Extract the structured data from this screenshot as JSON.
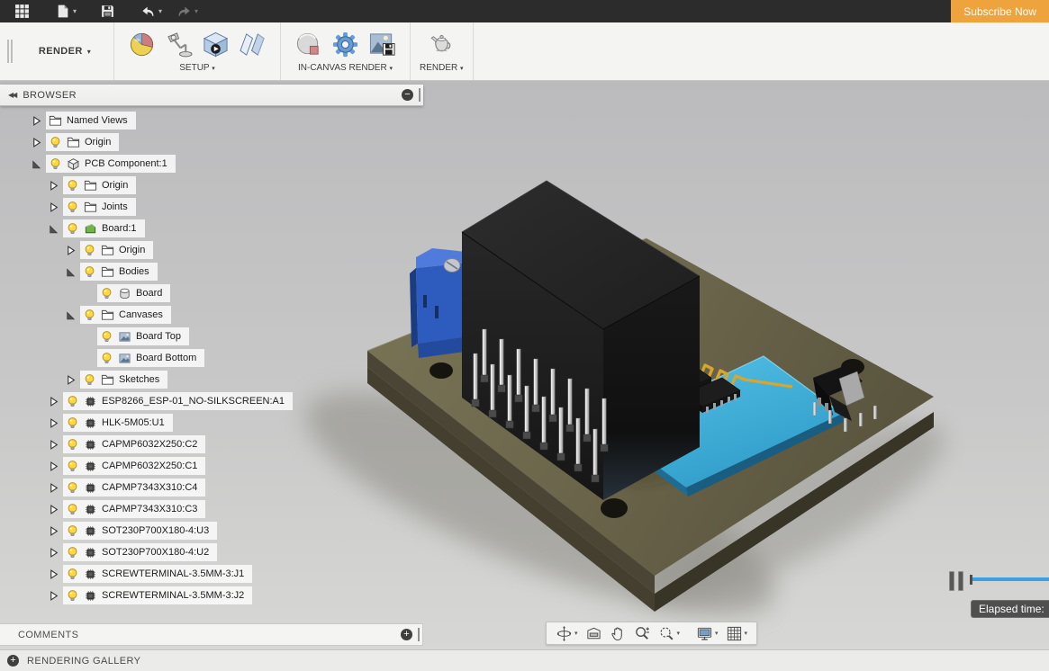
{
  "topbar": {
    "subscribe_label": "Subscribe Now",
    "icons": [
      "app-grid-icon",
      "file-icon",
      "save-icon",
      "undo-icon",
      "redo-icon"
    ]
  },
  "ribbon": {
    "workspace_label": "RENDER",
    "groups": [
      {
        "label": "SETUP",
        "icons": [
          "appearance-icon",
          "environment-icon",
          "decal-icon",
          "texture-icon"
        ]
      },
      {
        "label": "IN-CANVAS RENDER",
        "icons": [
          "incanvas-icon",
          "gear-icon",
          "capture-icon"
        ]
      },
      {
        "label": "RENDER",
        "icons": [
          "teapot-icon"
        ]
      }
    ]
  },
  "browser": {
    "title": "BROWSER",
    "tree": [
      {
        "label": "Named Views",
        "level": 0,
        "expand": "collapsed",
        "bulb": false,
        "icon": "folder"
      },
      {
        "label": "Origin",
        "level": 0,
        "expand": "collapsed",
        "bulb": true,
        "icon": "folder"
      },
      {
        "label": "PCB Component:1",
        "level": 0,
        "expand": "expanded",
        "bulb": true,
        "icon": "component"
      },
      {
        "label": "Origin",
        "level": 1,
        "expand": "collapsed",
        "bulb": true,
        "icon": "folder"
      },
      {
        "label": "Joints",
        "level": 1,
        "expand": "collapsed",
        "bulb": true,
        "icon": "folder"
      },
      {
        "label": "Board:1",
        "level": 1,
        "expand": "expanded",
        "bulb": true,
        "icon": "board"
      },
      {
        "label": "Origin",
        "level": 2,
        "expand": "collapsed",
        "bulb": true,
        "icon": "folder"
      },
      {
        "label": "Bodies",
        "level": 2,
        "expand": "expanded",
        "bulb": true,
        "icon": "folder"
      },
      {
        "label": "Board",
        "level": 3,
        "expand": "none",
        "bulb": true,
        "icon": "body"
      },
      {
        "label": "Canvases",
        "level": 2,
        "expand": "expanded",
        "bulb": true,
        "icon": "folder"
      },
      {
        "label": "Board Top",
        "level": 3,
        "expand": "none",
        "bulb": true,
        "icon": "canvas"
      },
      {
        "label": "Board Bottom",
        "level": 3,
        "expand": "none",
        "bulb": true,
        "icon": "canvas"
      },
      {
        "label": "Sketches",
        "level": 2,
        "expand": "collapsed",
        "bulb": true,
        "icon": "folder"
      },
      {
        "label": "ESP8266_ESP-01_NO-SILKSCREEN:A1",
        "level": 1,
        "expand": "collapsed",
        "bulb": true,
        "icon": "chip"
      },
      {
        "label": "HLK-5M05:U1",
        "level": 1,
        "expand": "collapsed",
        "bulb": true,
        "icon": "chip"
      },
      {
        "label": "CAPMP6032X250:C2",
        "level": 1,
        "expand": "collapsed",
        "bulb": true,
        "icon": "chip"
      },
      {
        "label": "CAPMP6032X250:C1",
        "level": 1,
        "expand": "collapsed",
        "bulb": true,
        "icon": "chip"
      },
      {
        "label": "CAPMP7343X310:C4",
        "level": 1,
        "expand": "collapsed",
        "bulb": true,
        "icon": "chip"
      },
      {
        "label": "CAPMP7343X310:C3",
        "level": 1,
        "expand": "collapsed",
        "bulb": true,
        "icon": "chip"
      },
      {
        "label": "SOT230P700X180-4:U3",
        "level": 1,
        "expand": "collapsed",
        "bulb": true,
        "icon": "chip"
      },
      {
        "label": "SOT230P700X180-4:U2",
        "level": 1,
        "expand": "collapsed",
        "bulb": true,
        "icon": "chip"
      },
      {
        "label": "SCREWTERMINAL-3.5MM-3:J1",
        "level": 1,
        "expand": "collapsed",
        "bulb": true,
        "icon": "chip"
      },
      {
        "label": "SCREWTERMINAL-3.5MM-3:J2",
        "level": 1,
        "expand": "collapsed",
        "bulb": true,
        "icon": "chip"
      }
    ]
  },
  "comments": {
    "title": "COMMENTS"
  },
  "gallery": {
    "title": "RENDERING GALLERY"
  },
  "render_progress": {
    "tooltip": "Elapsed time:"
  },
  "nav_toolbar": {
    "items": [
      {
        "name": "orbit",
        "icon": "orbit",
        "caret": true,
        "gap_after": false
      },
      {
        "name": "look-at",
        "icon": "lookat",
        "caret": false,
        "gap_after": false
      },
      {
        "name": "pan",
        "icon": "pan",
        "caret": false,
        "gap_after": false
      },
      {
        "name": "zoom",
        "icon": "zoom",
        "caret": false,
        "gap_after": false
      },
      {
        "name": "zoom-window",
        "icon": "zoomwin",
        "caret": true,
        "gap_after": true
      },
      {
        "name": "display-settings",
        "icon": "display",
        "caret": true,
        "gap_after": false
      },
      {
        "name": "grid-display",
        "icon": "gridvp",
        "caret": true,
        "gap_after": false
      }
    ]
  },
  "colors": {
    "accent_orange": "#efa33d",
    "progress_blue": "#3b9fe0"
  }
}
